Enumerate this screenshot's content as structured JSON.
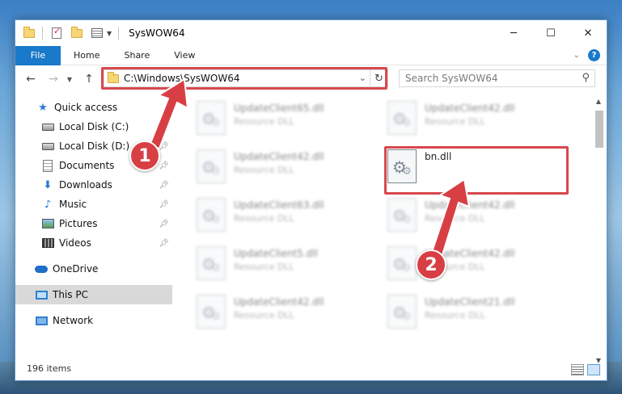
{
  "window": {
    "title": "SysWOW64",
    "controls": {
      "minimize": "─",
      "maximize": "☐",
      "close": "✕"
    }
  },
  "ribbon": {
    "file_tab": "File",
    "tabs": [
      "Home",
      "Share",
      "View"
    ],
    "help": "?"
  },
  "navbar": {
    "address": "C:\\Windows\\SysWOW64",
    "search_placeholder": "Search SysWOW64"
  },
  "sidebar": {
    "items": [
      {
        "label": "Quick access",
        "icon": "star-icon",
        "pinned": false
      },
      {
        "label": "Local Disk (C:)",
        "icon": "disk-icon",
        "pinned": true
      },
      {
        "label": "Local Disk (D:)",
        "icon": "disk-icon",
        "pinned": true
      },
      {
        "label": "Documents",
        "icon": "documents-icon",
        "pinned": true
      },
      {
        "label": "Downloads",
        "icon": "download-icon",
        "pinned": true
      },
      {
        "label": "Music",
        "icon": "music-icon",
        "pinned": true
      },
      {
        "label": "Pictures",
        "icon": "pictures-icon",
        "pinned": true
      },
      {
        "label": "Videos",
        "icon": "videos-icon",
        "pinned": true
      },
      {
        "label": "OneDrive",
        "icon": "cloud-icon",
        "pinned": false
      },
      {
        "label": "This PC",
        "icon": "pc-icon",
        "pinned": false,
        "selected": true
      },
      {
        "label": "Network",
        "icon": "network-icon",
        "pinned": false
      }
    ]
  },
  "files": [
    {
      "name": "UpdateClient65.dll",
      "type": "Resource DLL"
    },
    {
      "name": "UpdateClient42.dll",
      "type": "Resource DLL"
    },
    {
      "name": "UpdateClient42.dll",
      "type": "Resource DLL"
    },
    {
      "name": "bn.dll",
      "type": ""
    },
    {
      "name": "UpdateClient63.dll",
      "type": "Resource DLL"
    },
    {
      "name": "UpdateClient42.dll",
      "type": "Resource DLL"
    },
    {
      "name": "UpdateClient5.dll",
      "type": "Resource DLL"
    },
    {
      "name": "UpdateClient42.dll",
      "type": "Resource DLL"
    },
    {
      "name": "UpdateClient42.dll",
      "type": "Resource DLL"
    },
    {
      "name": "UpdateClient21.dll",
      "type": "Resource DLL"
    }
  ],
  "status": {
    "item_count": "196 items"
  },
  "callouts": {
    "step1": "1",
    "step2": "2"
  },
  "colors": {
    "accent": "#1979ca",
    "highlight": "#d9474e"
  }
}
